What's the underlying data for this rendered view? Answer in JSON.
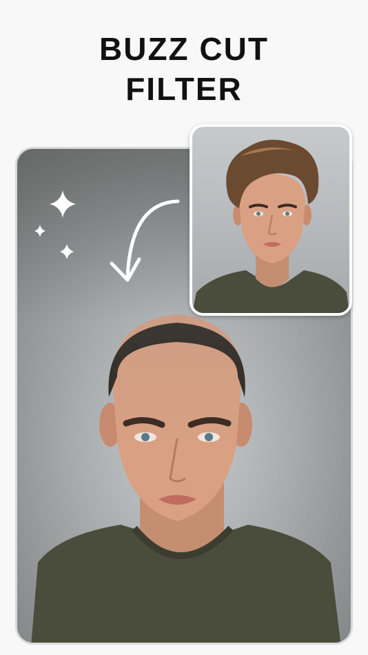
{
  "header": {
    "title_line1": "BUZZ CUT",
    "title_line2": "FILTER"
  },
  "images": {
    "after": {
      "icon": "buzz-cut-portrait"
    },
    "before": {
      "icon": "long-hair-portrait"
    }
  },
  "decor": {
    "sparkle_icon": "sparkle-icon",
    "arrow_icon": "curved-arrow-icon"
  },
  "colors": {
    "background": "#f8f8f8",
    "title": "#111111",
    "card_border": "#d9d9d9"
  }
}
